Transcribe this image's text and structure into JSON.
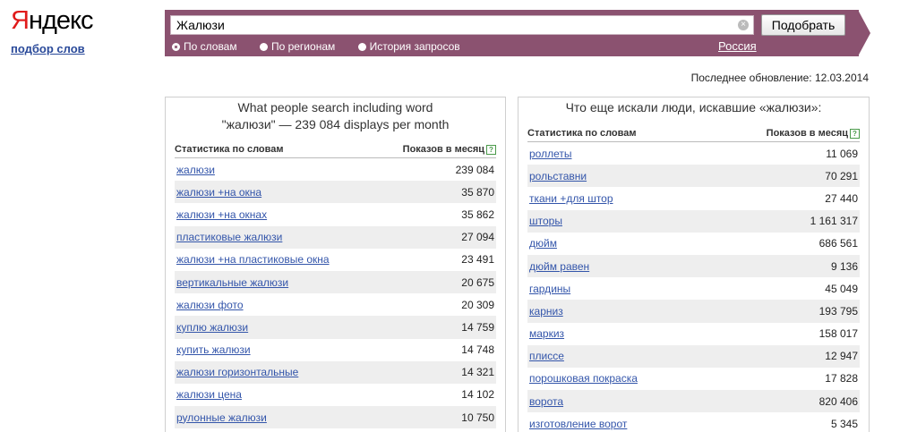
{
  "logo": {
    "first": "Я",
    "rest": "ндекс"
  },
  "subtitle": "подбор слов",
  "search": {
    "value": "Жалюзи",
    "submit_label": "Подобрать",
    "clear_icon": "×"
  },
  "radios": [
    {
      "label": "По словам",
      "selected": true
    },
    {
      "label": "По регионам",
      "selected": false
    },
    {
      "label": "История запросов",
      "selected": false
    }
  ],
  "region": "Россия",
  "last_update": "Последнее обновление: 12.03.2014",
  "left_panel": {
    "title_line1": "What people search including word",
    "title_line2": "\"жалюзи\" — 239 084 displays per month",
    "col_keyword": "Статистика по словам",
    "col_count": "Показов в месяц",
    "rows": [
      {
        "kw": "жалюзи",
        "cnt": "239 084"
      },
      {
        "kw": "жалюзи +на окна",
        "cnt": "35 870"
      },
      {
        "kw": "жалюзи +на окнах",
        "cnt": "35 862"
      },
      {
        "kw": "пластиковые жалюзи",
        "cnt": "27 094"
      },
      {
        "kw": "жалюзи +на пластиковые окна",
        "cnt": "23 491"
      },
      {
        "kw": "вертикальные жалюзи",
        "cnt": "20 675"
      },
      {
        "kw": "жалюзи фото",
        "cnt": "20 309"
      },
      {
        "kw": "куплю жалюзи",
        "cnt": "14 759"
      },
      {
        "kw": "купить жалюзи",
        "cnt": "14 748"
      },
      {
        "kw": "жалюзи горизонтальные",
        "cnt": "14 321"
      },
      {
        "kw": "жалюзи цена",
        "cnt": "14 102"
      },
      {
        "kw": "рулонные жалюзи",
        "cnt": "10 750"
      }
    ]
  },
  "right_panel": {
    "title": "Что еще искали люди, искавшие «жалюзи»:",
    "col_keyword": "Статистика по словам",
    "col_count": "Показов в месяц",
    "rows": [
      {
        "kw": "роллеты",
        "cnt": "11 069"
      },
      {
        "kw": "рольставни",
        "cnt": "70 291"
      },
      {
        "kw": "ткани +для штор",
        "cnt": "27 440"
      },
      {
        "kw": "шторы",
        "cnt": "1 161 317"
      },
      {
        "kw": "дюйм",
        "cnt": "686 561"
      },
      {
        "kw": "дюйм равен",
        "cnt": "9 136"
      },
      {
        "kw": "гардины",
        "cnt": "45 049"
      },
      {
        "kw": "карниз",
        "cnt": "193 795"
      },
      {
        "kw": "маркиз",
        "cnt": "158 017"
      },
      {
        "kw": "плиссе",
        "cnt": "12 947"
      },
      {
        "kw": "порошковая покраска",
        "cnt": "17 828"
      },
      {
        "kw": "ворота",
        "cnt": "820 406"
      },
      {
        "kw": "изготовление ворот",
        "cnt": "5 345"
      }
    ]
  },
  "help_icon": "?"
}
